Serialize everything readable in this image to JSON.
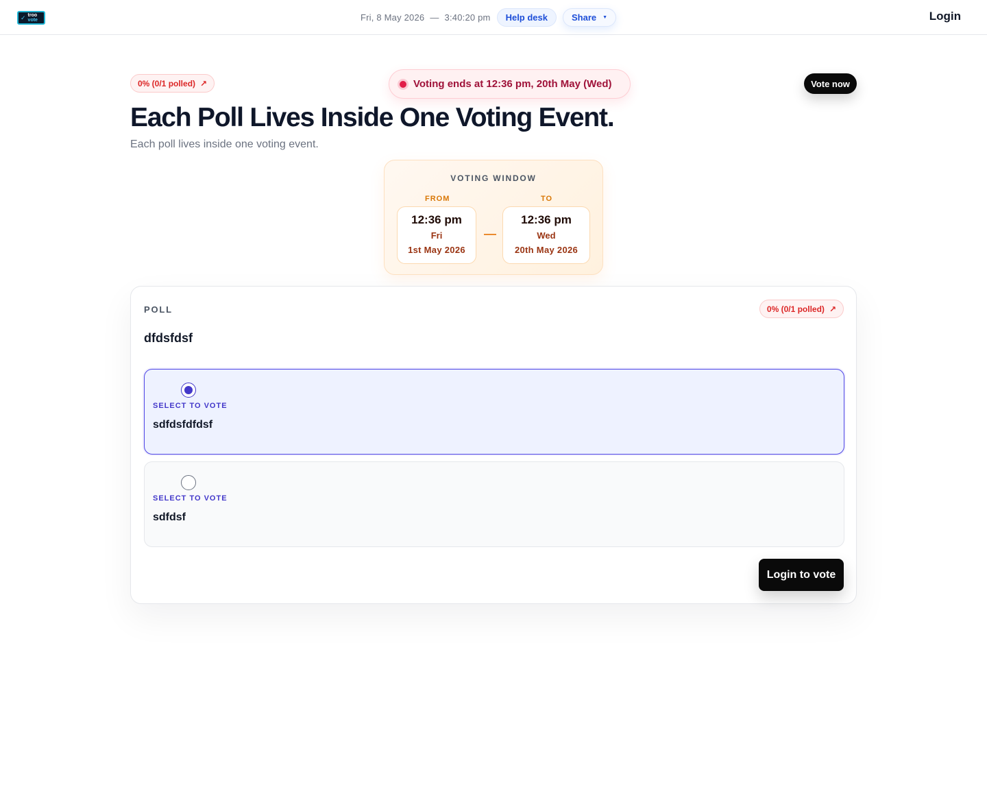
{
  "header": {
    "logo_line1": "troo",
    "logo_line2": "vote",
    "date": "Fri, 8 May 2026",
    "separator": "—",
    "time": "3:40:20 pm",
    "help_label": "Help desk",
    "share_label": "Share",
    "login_label": "Login"
  },
  "event": {
    "polled_badge": "0% (0/1 polled)",
    "ends_text": "Voting ends at 12:36 pm, 20th May (Wed)",
    "vote_now_label": "Vote now",
    "title": "Each Poll Lives Inside One Voting Event.",
    "subtitle": "Each poll lives inside one voting event."
  },
  "voting_window": {
    "title": "VOTING WINDOW",
    "from": {
      "label": "FROM",
      "time": "12:36 pm",
      "day": "Fri",
      "date": "1st May 2026"
    },
    "to": {
      "label": "TO",
      "time": "12:36 pm",
      "day": "Wed",
      "date": "20th May 2026"
    }
  },
  "poll": {
    "label": "POLL",
    "polled_badge": "0% (0/1 polled)",
    "question": "dfdsfdsf",
    "options": [
      {
        "hint": "SELECT TO VOTE",
        "label": "sdfdsfdfdsf",
        "selected": true
      },
      {
        "hint": "SELECT TO VOTE",
        "label": "sdfdsf",
        "selected": false
      }
    ],
    "login_vote_label": "Login to vote"
  },
  "colors": {
    "accent": "#4338ca",
    "danger": "#dc2626",
    "warm": "#d97706"
  }
}
